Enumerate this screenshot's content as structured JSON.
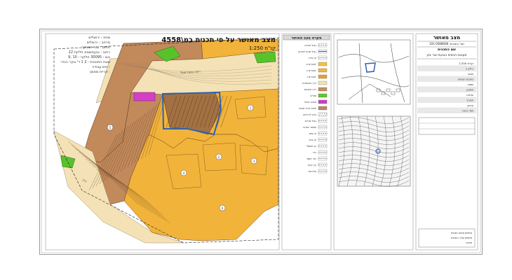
{
  "main_title": "מצב מאושר על פי תכנית במ\\4558",
  "scale_label": "קנ\"מ 1:250",
  "left_info": [
    "מחוז : ירושלים",
    "מרחב : ירושלים",
    "תחום : גבר חבבקר",
    "רחוב : גבעתשמא חלקת 22",
    "גוש : 30095 חלקה : 10 ,9",
    "שטח התוכנית : 2 1 ד' ונקר הגדר",
    "יוזם עבודה :",
    "קריית מסמך :"
  ],
  "legend": {
    "title": "מקרא מצב מאושר",
    "rows": [
      {
        "color": "#ffffff",
        "pattern": "dash",
        "label": "גבול תכנית"
      },
      {
        "color": "#ffffff",
        "pattern": "blue",
        "label": "גבול שטח לתכנון"
      },
      {
        "color": "#ffffff",
        "pattern": "line",
        "label": "קו בניין"
      },
      {
        "color": "#f6c23a",
        "pattern": "fill",
        "label": "מגורים א'"
      },
      {
        "color": "#f3b73a",
        "pattern": "fill",
        "label": "מגורים ב'"
      },
      {
        "color": "#e9a030",
        "pattern": "fill",
        "label": "מגורים ג'"
      },
      {
        "color": "#f5e3b3",
        "pattern": "fill",
        "label": "דרך מאושרת"
      },
      {
        "color": "#c98e5d",
        "pattern": "fill",
        "label": "דרך מוצעת"
      },
      {
        "color": "#5fc633",
        "pattern": "fill",
        "label": "שצ\"פ"
      },
      {
        "color": "#d03ec5",
        "pattern": "fill",
        "label": "מבנה ציבור"
      },
      {
        "color": "#bb8866",
        "pattern": "fill",
        "label": "שטח פרטי פתוח"
      },
      {
        "color": "#ffffff",
        "pattern": "hatch",
        "label": "בניין להריסה"
      },
      {
        "color": "#ffffff",
        "pattern": "dash",
        "label": "גבול מגרש"
      },
      {
        "color": "#ffffff",
        "pattern": "line",
        "label": "מספר מגרש"
      },
      {
        "color": "#ffffff",
        "pattern": "dash",
        "label": "קו מים"
      },
      {
        "color": "#ffffff",
        "pattern": "line",
        "label": "קו ביוב"
      },
      {
        "color": "#ffffff",
        "pattern": "dash",
        "label": "קו חשמל"
      },
      {
        "color": "#ffffff",
        "pattern": "line",
        "label": "גדר"
      },
      {
        "color": "#ffffff",
        "pattern": "line",
        "label": "קיר תומך"
      },
      {
        "color": "#ffffff",
        "pattern": "dash",
        "label": "עץ קיים"
      },
      {
        "color": "#ffffff",
        "pattern": "line",
        "label": "מדרגות"
      }
    ]
  },
  "plot_labels": [
    "1",
    "2",
    "3",
    "4",
    "5",
    "6"
  ],
  "road_labels": [
    "רחוב גבעת שאול",
    "דרך"
  ],
  "title_block": {
    "header": "מצב מאושר",
    "plan_number": "מס' התכנית: 101-0588608",
    "plan_name_label": "שם התכנית",
    "plan_name": "מעונות הבסיס בגבעת אור ציון",
    "info_rows": [
      "קנ\"מ 1:250",
      "גיליון 1",
      "מגיש",
      "כתובת המגיש",
      "שמאי",
      "מתכנן",
      "שרטט",
      "תאריך",
      "עדכון",
      "מס' גרסה"
    ],
    "bottom_rows": [
      "חתימת מגיש התכנית",
      "חתימת עורך התכנית",
      "תאריך"
    ]
  },
  "colors": {
    "residential": "#f2b33a",
    "residential_light": "#f6c860",
    "road": "#f4e2b6",
    "brown": "#c2895b",
    "green": "#58c22b",
    "magenta": "#d53fc8",
    "boundary_blue": "#2c62b3"
  }
}
